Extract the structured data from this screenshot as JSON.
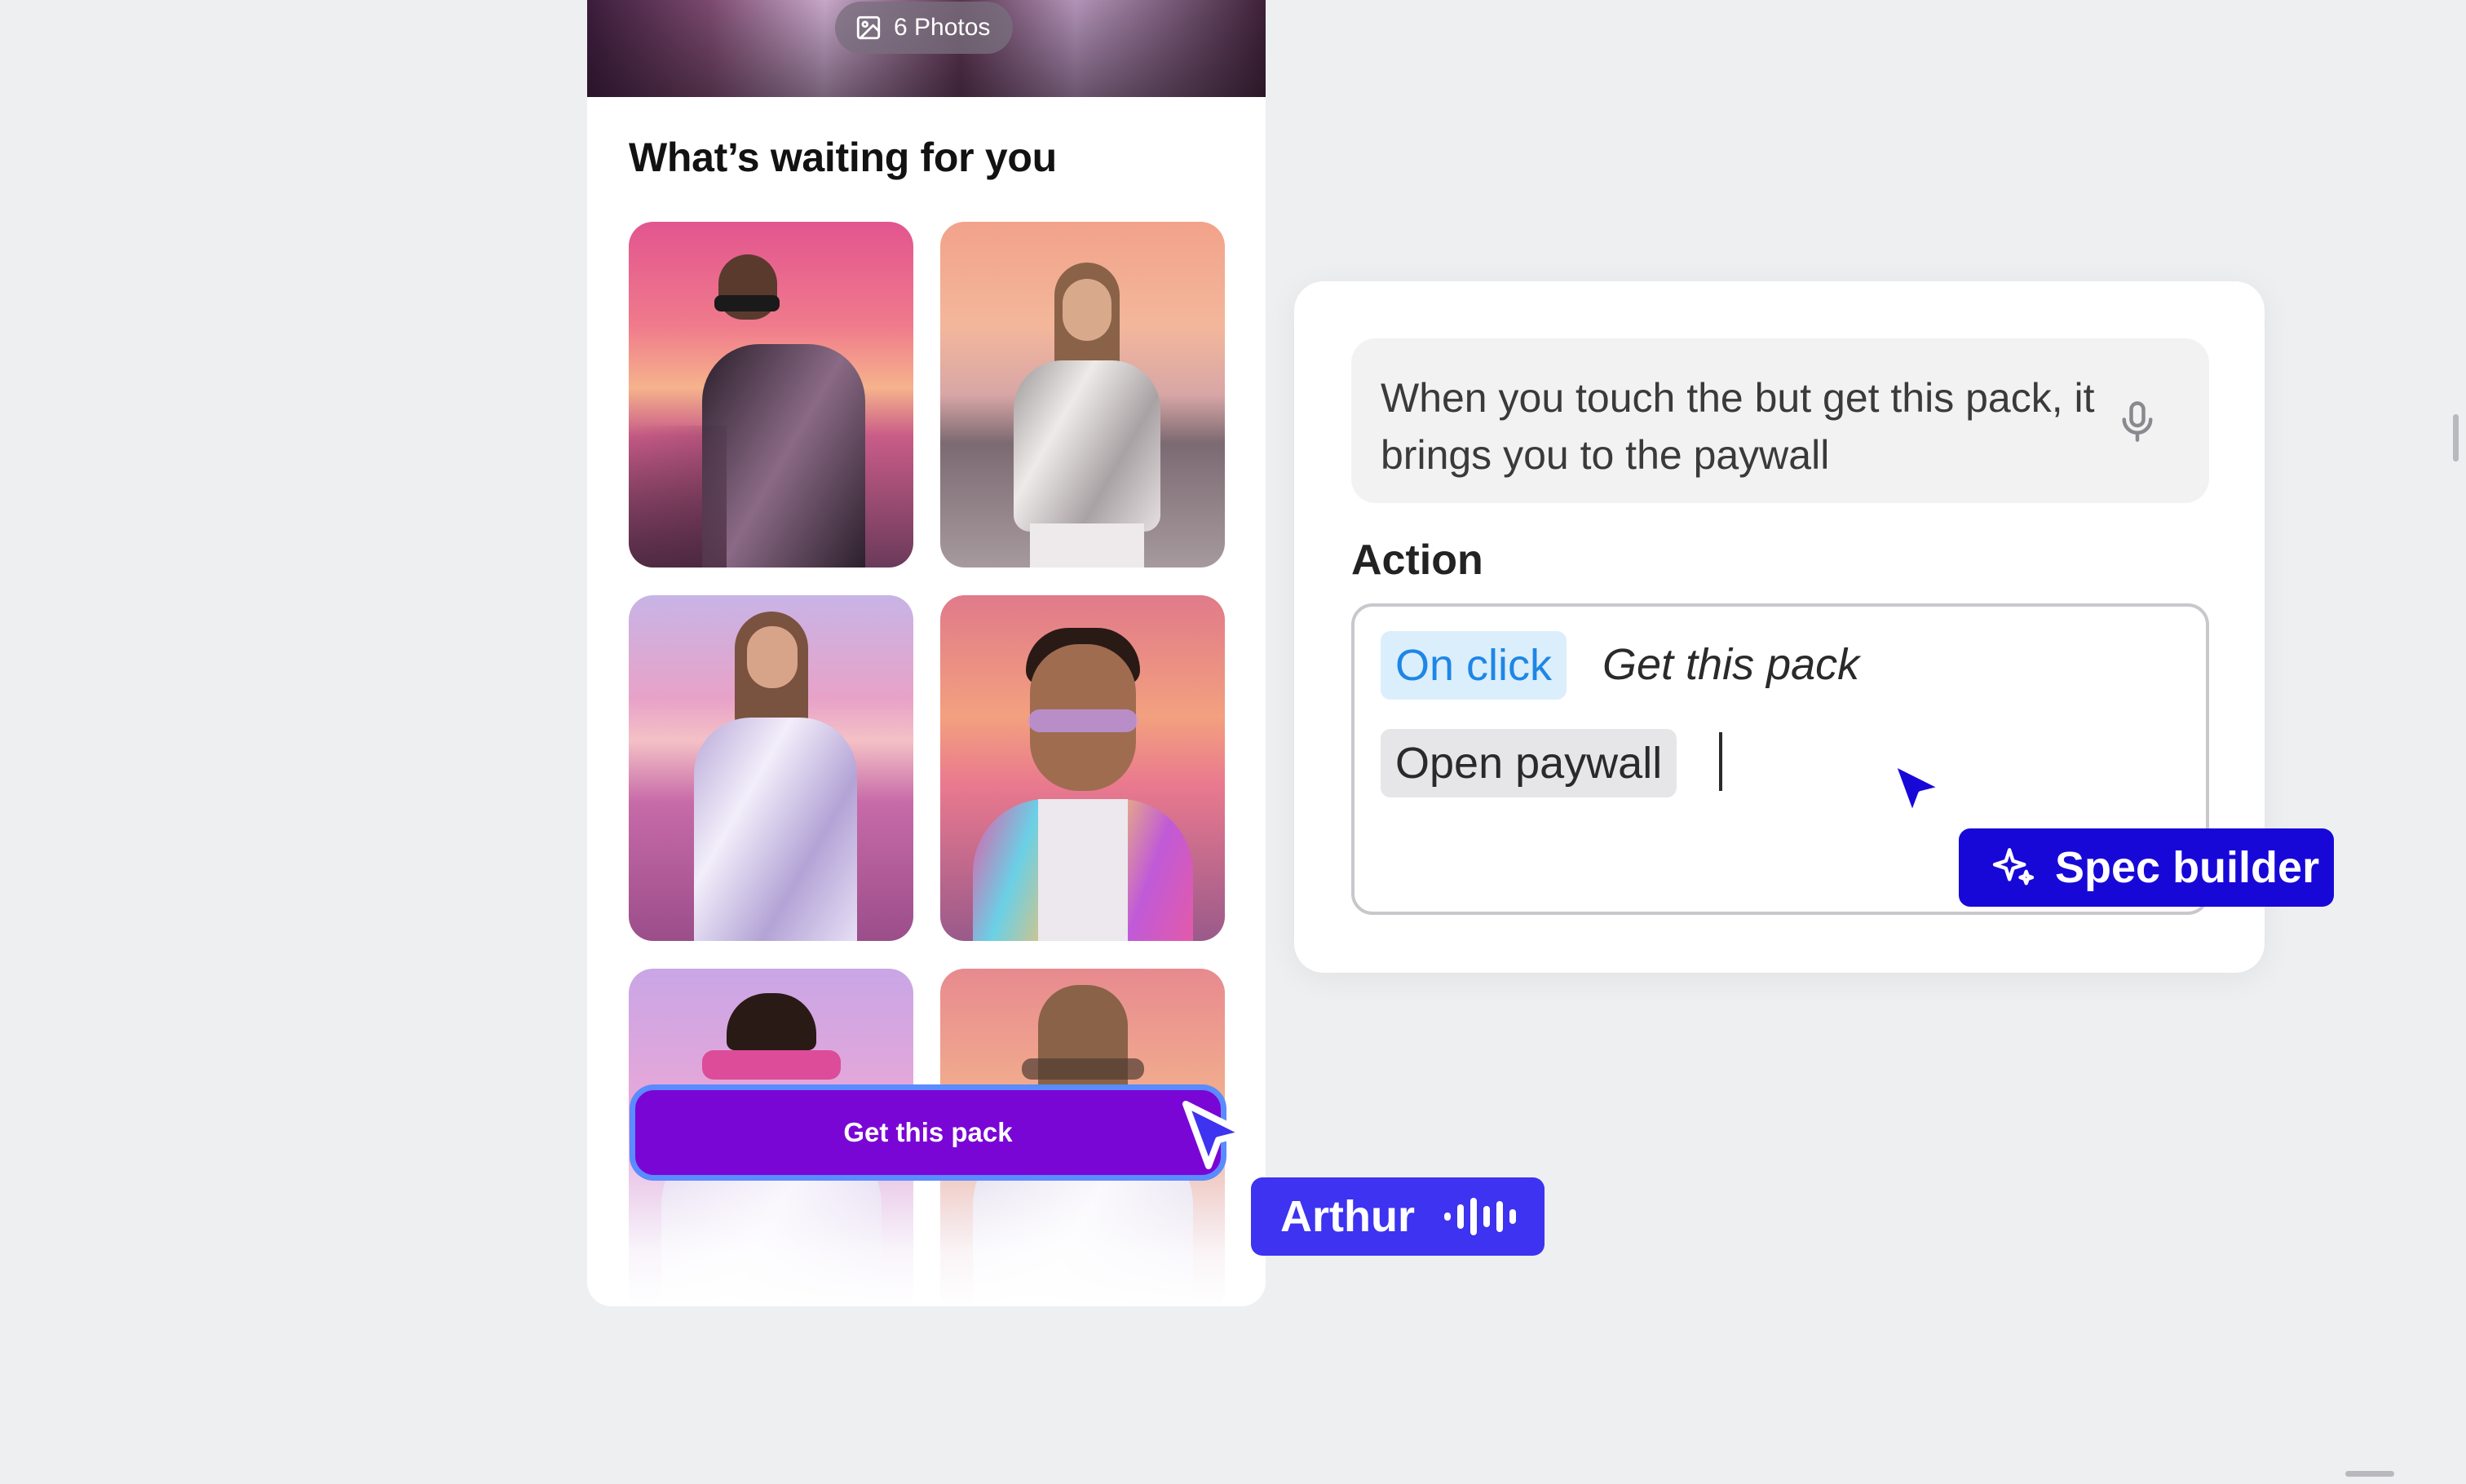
{
  "pack": {
    "photo_count_label": "6 Photos",
    "section_title": "What’s waiting for you",
    "cta_label": "Get this pack"
  },
  "spec_card": {
    "prompt_text": "When you touch the but get this pack, it brings you to the paywall",
    "action_label": "Action",
    "trigger_chip": "On click",
    "trigger_target": "Get this pack",
    "result_chip": "Open paywall"
  },
  "collaborators": {
    "spec_builder_label": "Spec builder",
    "user_label": "Arthur"
  },
  "colors": {
    "cta": "#7a06d6",
    "cta_border": "#5a8bff",
    "trigger_chip_text": "#1e86e6",
    "spec_builder_tag": "#1808d8",
    "user_tag": "#3d33f0"
  },
  "icons": {
    "badge": "image-icon",
    "prompt": "microphone-icon",
    "spec_builder": "sparkles-icon",
    "user": "audio-waveform-icon"
  }
}
